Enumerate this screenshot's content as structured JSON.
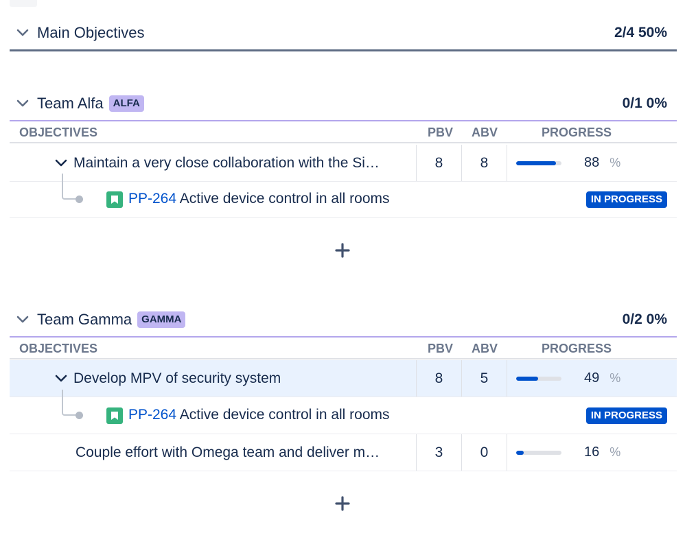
{
  "main": {
    "title": "Main Objectives",
    "summary": "2/4 50%"
  },
  "columns": {
    "objectives": "OBJECTIVES",
    "pbv": "PBV",
    "abv": "ABV",
    "progress": "PROGRESS"
  },
  "teams": [
    {
      "name": "Team Alfa",
      "badge": "ALFA",
      "summary": "0/1 0%",
      "objectives": [
        {
          "title": "Maintain a very close collaboration with the Si…",
          "pbv": "8",
          "abv": "8",
          "progress": 88,
          "progress_label": "88",
          "pct": "%",
          "children": [
            {
              "key": "PP-264",
              "summary": "Active device control in all rooms",
              "status": "IN PROGRESS"
            }
          ]
        }
      ]
    },
    {
      "name": "Team Gamma",
      "badge": "GAMMA",
      "summary": "0/2 0%",
      "objectives": [
        {
          "title": "Develop MPV of security system",
          "pbv": "8",
          "abv": "5",
          "progress": 49,
          "progress_label": "49",
          "pct": "%",
          "children": [
            {
              "key": "PP-264",
              "summary": "Active device control in all rooms",
              "status": "IN PROGRESS"
            }
          ]
        },
        {
          "title": "Couple effort with Omega team and deliver m…",
          "pbv": "3",
          "abv": "0",
          "progress": 16,
          "progress_label": "16",
          "pct": "%",
          "children": []
        }
      ]
    }
  ],
  "icons": {
    "expand": "chevron-down-icon",
    "add": "plus-icon",
    "story": "story-bookmark-icon"
  },
  "colors": {
    "accent": "#0052cc",
    "badge": "#c0b6f2",
    "story": "#36b37e",
    "highlight": "#e9f2fe"
  }
}
